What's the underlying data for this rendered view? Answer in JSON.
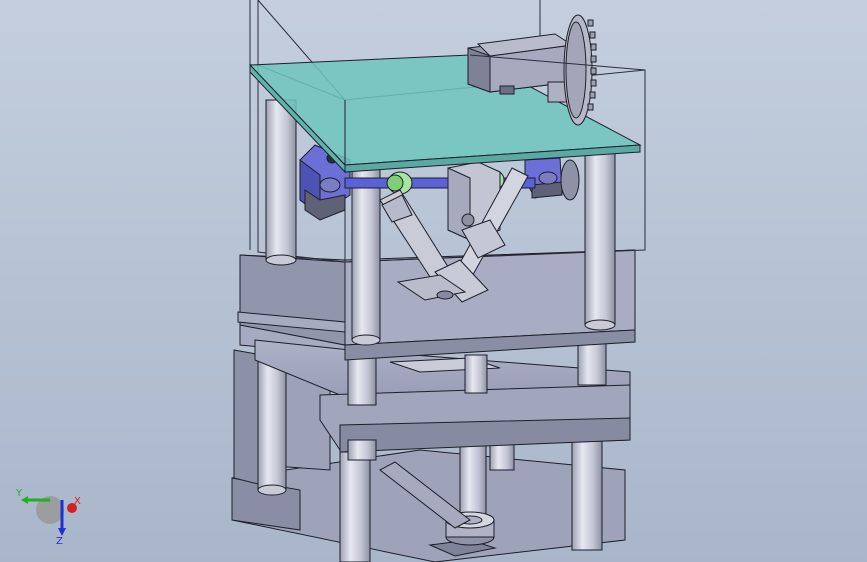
{
  "viewport": {
    "background": "#b9c4d6",
    "model_name": "mechanical-assembly-3d-view"
  },
  "colors": {
    "plate_gray": "#a3a7bf",
    "plate_dark": "#7f8399",
    "rod_light": "#d9dbe6",
    "glass_teal": "#6fc5be",
    "bearing_blue": "#6b6fd6",
    "collar_green": "#a8e6a0",
    "edge": "#1d1f29"
  },
  "triad": {
    "x_label": "X",
    "y_label": "Y",
    "z_label": "Z",
    "x_color": "#d62020",
    "y_color": "#20b020",
    "z_color": "#2030d0"
  }
}
